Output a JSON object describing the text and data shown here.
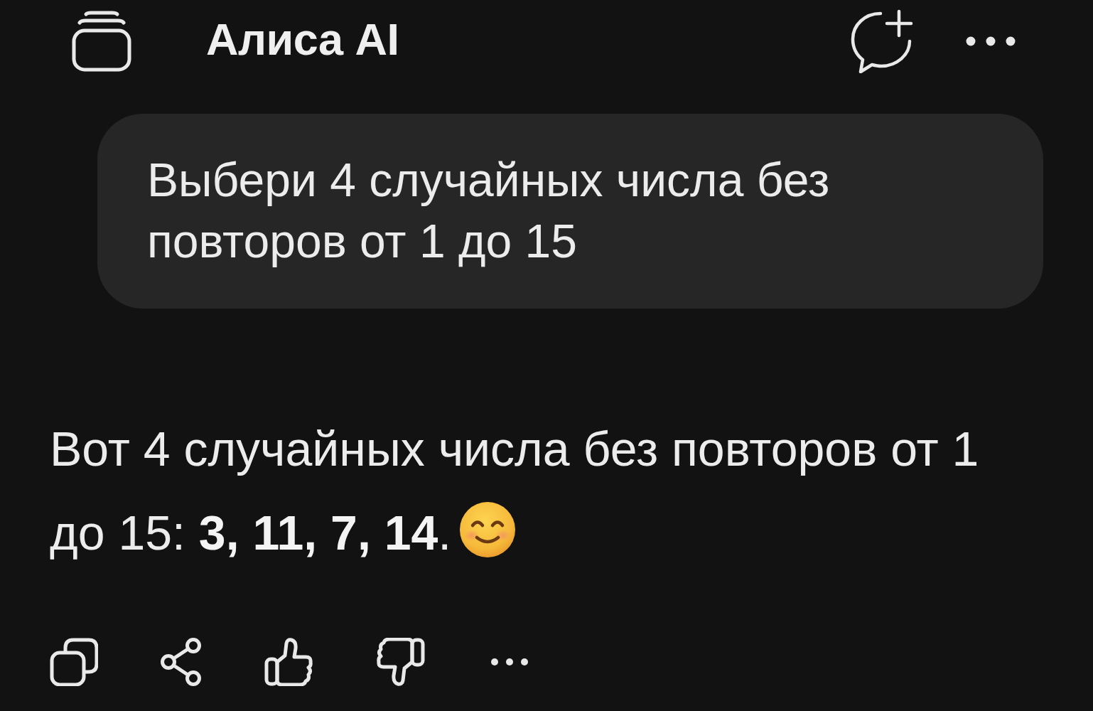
{
  "header": {
    "title": "Алиса AI"
  },
  "messages": [
    {
      "kind": "user",
      "text": "Выбери 4 случайных числа без повторов от 1 до 15"
    },
    {
      "kind": "assistant",
      "lines": [
        "Вот 4 случайных числа без повторов от 1",
        "до 15: **3, 11, 7, 14**."
      ]
    }
  ]
}
